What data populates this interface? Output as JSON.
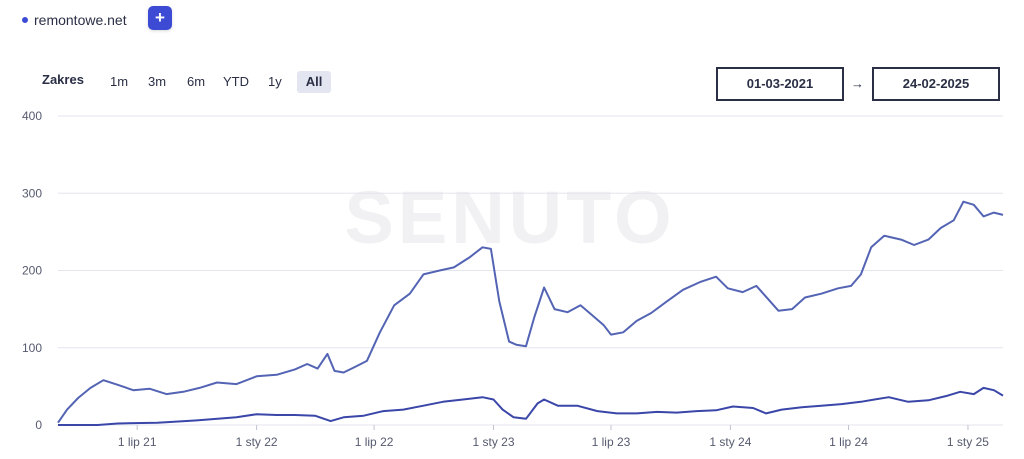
{
  "domain": {
    "name": "remontowe.net",
    "add_label": "+"
  },
  "range": {
    "label": "Zakres",
    "options": [
      "1m",
      "3m",
      "6m",
      "YTD",
      "1y",
      "All"
    ],
    "active": "All"
  },
  "dates": {
    "from": "01-03-2021",
    "arrow": "→",
    "to": "24-02-2025"
  },
  "watermark": "SENUTO",
  "colors": {
    "accent": "#3d4bd4",
    "series_main": "#5464b4",
    "series_secondary": "#3a46a8"
  },
  "chart_data": {
    "type": "line",
    "title": "",
    "xlabel": "",
    "ylabel": "",
    "ylim": [
      0,
      400
    ],
    "yticks": [
      0,
      100,
      200,
      300,
      400
    ],
    "grid": true,
    "x_range": [
      "2021-03-01",
      "2025-02-24"
    ],
    "xticks": [
      {
        "date": "2021-07-01",
        "label": "1 lip 21"
      },
      {
        "date": "2022-01-01",
        "label": "1 sty 22"
      },
      {
        "date": "2022-07-01",
        "label": "1 lip 22"
      },
      {
        "date": "2023-01-01",
        "label": "1 sty 23"
      },
      {
        "date": "2023-07-01",
        "label": "1 lip 23"
      },
      {
        "date": "2024-01-01",
        "label": "1 sty 24"
      },
      {
        "date": "2024-07-01",
        "label": "1 lip 24"
      },
      {
        "date": "2025-01-01",
        "label": "1 sty 25"
      }
    ],
    "series": [
      {
        "points": [
          [
            "2021-03-01",
            3
          ],
          [
            "2021-03-15",
            20
          ],
          [
            "2021-04-01",
            35
          ],
          [
            "2021-04-20",
            48
          ],
          [
            "2021-05-10",
            58
          ],
          [
            "2021-06-01",
            52
          ],
          [
            "2021-06-25",
            45
          ],
          [
            "2021-07-20",
            47
          ],
          [
            "2021-08-15",
            40
          ],
          [
            "2021-09-10",
            43
          ],
          [
            "2021-10-05",
            48
          ],
          [
            "2021-11-01",
            55
          ],
          [
            "2021-12-01",
            53
          ],
          [
            "2022-01-01",
            63
          ],
          [
            "2022-02-01",
            65
          ],
          [
            "2022-03-01",
            72
          ],
          [
            "2022-03-20",
            79
          ],
          [
            "2022-04-05",
            73
          ],
          [
            "2022-04-20",
            92
          ],
          [
            "2022-05-01",
            70
          ],
          [
            "2022-05-15",
            68
          ],
          [
            "2022-06-01",
            75
          ],
          [
            "2022-06-20",
            83
          ],
          [
            "2022-07-10",
            120
          ],
          [
            "2022-08-01",
            155
          ],
          [
            "2022-08-25",
            170
          ],
          [
            "2022-09-15",
            195
          ],
          [
            "2022-10-10",
            200
          ],
          [
            "2022-11-01",
            204
          ],
          [
            "2022-11-25",
            217
          ],
          [
            "2022-12-15",
            230
          ],
          [
            "2022-12-28",
            228
          ],
          [
            "2023-01-10",
            160
          ],
          [
            "2023-01-25",
            108
          ],
          [
            "2023-02-05",
            104
          ],
          [
            "2023-02-20",
            102
          ],
          [
            "2023-03-05",
            140
          ],
          [
            "2023-03-20",
            178
          ],
          [
            "2023-04-05",
            150
          ],
          [
            "2023-04-25",
            146
          ],
          [
            "2023-05-15",
            155
          ],
          [
            "2023-06-05",
            140
          ],
          [
            "2023-06-20",
            129
          ],
          [
            "2023-07-01",
            117
          ],
          [
            "2023-07-20",
            120
          ],
          [
            "2023-08-10",
            135
          ],
          [
            "2023-09-01",
            145
          ],
          [
            "2023-09-25",
            160
          ],
          [
            "2023-10-20",
            175
          ],
          [
            "2023-11-15",
            185
          ],
          [
            "2023-12-10",
            192
          ],
          [
            "2023-12-28",
            177
          ],
          [
            "2024-01-20",
            172
          ],
          [
            "2024-02-10",
            180
          ],
          [
            "2024-02-25",
            166
          ],
          [
            "2024-03-15",
            148
          ],
          [
            "2024-04-05",
            150
          ],
          [
            "2024-04-25",
            165
          ],
          [
            "2024-05-20",
            170
          ],
          [
            "2024-06-15",
            177
          ],
          [
            "2024-07-05",
            180
          ],
          [
            "2024-07-20",
            195
          ],
          [
            "2024-08-05",
            230
          ],
          [
            "2024-08-25",
            245
          ],
          [
            "2024-09-20",
            240
          ],
          [
            "2024-10-10",
            233
          ],
          [
            "2024-11-01",
            240
          ],
          [
            "2024-11-20",
            255
          ],
          [
            "2024-12-10",
            265
          ],
          [
            "2024-12-25",
            289
          ],
          [
            "2025-01-10",
            285
          ],
          [
            "2025-01-25",
            270
          ],
          [
            "2025-02-10",
            275
          ],
          [
            "2025-02-24",
            272
          ]
        ]
      },
      {
        "points": [
          [
            "2021-03-01",
            0
          ],
          [
            "2021-05-01",
            0
          ],
          [
            "2021-06-01",
            2
          ],
          [
            "2021-08-01",
            3
          ],
          [
            "2021-10-01",
            6
          ],
          [
            "2021-12-01",
            10
          ],
          [
            "2022-01-01",
            14
          ],
          [
            "2022-02-01",
            13
          ],
          [
            "2022-03-01",
            13
          ],
          [
            "2022-04-01",
            12
          ],
          [
            "2022-04-25",
            5
          ],
          [
            "2022-05-15",
            10
          ],
          [
            "2022-06-15",
            12
          ],
          [
            "2022-07-15",
            18
          ],
          [
            "2022-08-15",
            20
          ],
          [
            "2022-09-15",
            25
          ],
          [
            "2022-10-15",
            30
          ],
          [
            "2022-11-15",
            33
          ],
          [
            "2022-12-15",
            36
          ],
          [
            "2023-01-01",
            33
          ],
          [
            "2023-01-15",
            20
          ],
          [
            "2023-02-01",
            10
          ],
          [
            "2023-02-20",
            8
          ],
          [
            "2023-03-10",
            28
          ],
          [
            "2023-03-20",
            33
          ],
          [
            "2023-04-10",
            25
          ],
          [
            "2023-05-10",
            25
          ],
          [
            "2023-06-10",
            18
          ],
          [
            "2023-07-10",
            15
          ],
          [
            "2023-08-10",
            15
          ],
          [
            "2023-09-10",
            17
          ],
          [
            "2023-10-10",
            16
          ],
          [
            "2023-11-10",
            18
          ],
          [
            "2023-12-10",
            19
          ],
          [
            "2024-01-05",
            24
          ],
          [
            "2024-02-05",
            22
          ],
          [
            "2024-02-25",
            15
          ],
          [
            "2024-03-20",
            20
          ],
          [
            "2024-04-20",
            23
          ],
          [
            "2024-05-20",
            25
          ],
          [
            "2024-06-20",
            27
          ],
          [
            "2024-07-20",
            30
          ],
          [
            "2024-08-10",
            33
          ],
          [
            "2024-09-01",
            36
          ],
          [
            "2024-10-01",
            30
          ],
          [
            "2024-11-01",
            32
          ],
          [
            "2024-12-01",
            38
          ],
          [
            "2024-12-20",
            43
          ],
          [
            "2025-01-10",
            40
          ],
          [
            "2025-01-25",
            48
          ],
          [
            "2025-02-10",
            45
          ],
          [
            "2025-02-24",
            38
          ]
        ]
      }
    ]
  }
}
